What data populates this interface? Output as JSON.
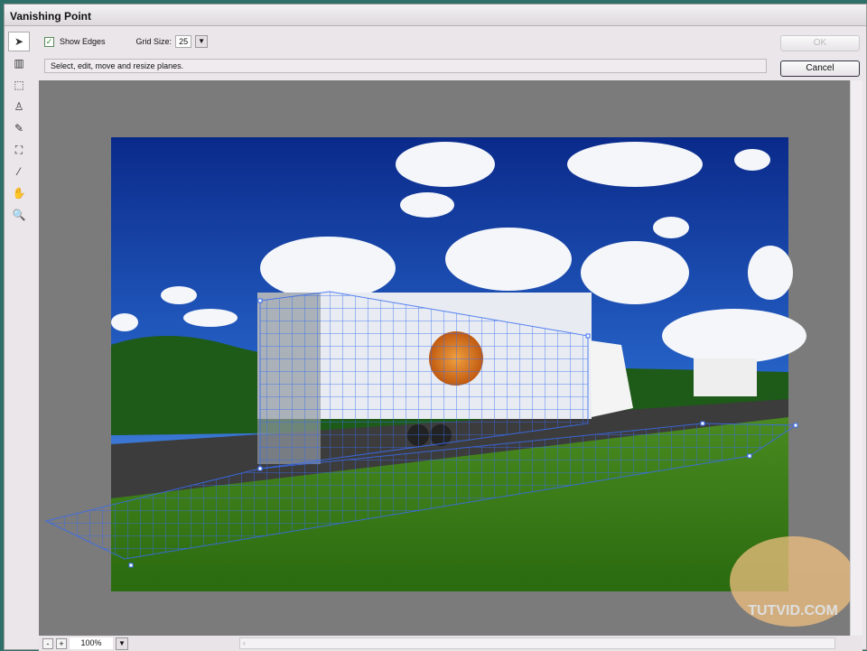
{
  "window": {
    "title": "Vanishing Point"
  },
  "options": {
    "show_edges_label": "Show Edges",
    "show_edges_checked": true,
    "grid_size_label": "Grid Size:",
    "grid_size_value": "25"
  },
  "status": "Select, edit, move and resize planes.",
  "buttons": {
    "ok": "OK",
    "cancel": "Cancel"
  },
  "tools": [
    "edit-plane-tool",
    "create-plane-tool",
    "marquee-tool",
    "stamp-tool",
    "brush-tool",
    "transform-tool",
    "eyedropper-tool",
    "hand-tool",
    "zoom-tool"
  ],
  "zoom": {
    "minus": "-",
    "plus": "+",
    "level": "100%"
  },
  "watermark": "TUTVID.COM"
}
